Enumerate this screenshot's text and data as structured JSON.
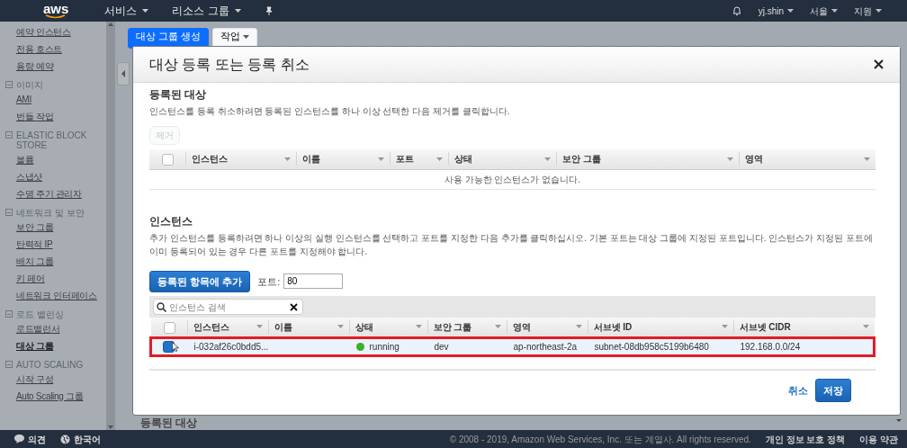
{
  "top_nav": {
    "logo": "aws",
    "menus": [
      {
        "label": "서비스"
      },
      {
        "label": "리소스 그룹"
      }
    ],
    "user": "yj.shin",
    "region": "서울",
    "support": "지원"
  },
  "sidebar": {
    "sections": [
      {
        "items": [
          {
            "label": "예약 인스턴스",
            "selected": false
          },
          {
            "label": "전용 호스트",
            "selected": false
          },
          {
            "label": "용량 예약",
            "selected": false
          }
        ]
      },
      {
        "title": "이미지",
        "items": [
          {
            "label": "AMI",
            "selected": false
          },
          {
            "label": "번들 작업",
            "selected": false
          }
        ]
      },
      {
        "title": "ELASTIC BLOCK STORE",
        "items": [
          {
            "label": "볼륨",
            "selected": false
          },
          {
            "label": "스냅샷",
            "selected": false
          },
          {
            "label": "수명 주기 관리자",
            "selected": false
          }
        ]
      },
      {
        "title": "네트워크 및 보안",
        "items": [
          {
            "label": "보안 그룹",
            "selected": false
          },
          {
            "label": "탄력적 IP",
            "selected": false
          },
          {
            "label": "배치 그룹",
            "selected": false
          },
          {
            "label": "키 페어",
            "selected": false
          },
          {
            "label": "네트워크 인터페이스",
            "selected": false
          }
        ]
      },
      {
        "title": "로드 밸런싱",
        "items": [
          {
            "label": "로드밸런서",
            "selected": false
          },
          {
            "label": "대상 그룹",
            "selected": true
          }
        ]
      },
      {
        "title": "AUTO SCALING",
        "items": [
          {
            "label": "시작 구성",
            "selected": false
          },
          {
            "label": "Auto Scaling 그룹",
            "selected": false
          }
        ]
      }
    ]
  },
  "page": {
    "buttons": [
      {
        "label": "대상 그룹 생성",
        "kind": "primary"
      },
      {
        "label": "작업",
        "kind": "dropdown"
      }
    ],
    "section_title": "등록된 대상"
  },
  "modal": {
    "title": "대상 등록 또는 등록 취소",
    "registered": {
      "title": "등록된 대상",
      "description": "인스턴스를 등록 취소하려면 등록된 인스턴스를 하나 이상 선택한 다음 제거를 클릭합니다.",
      "remove_button": {
        "label": "제거",
        "disabled": true
      },
      "all_selected": false,
      "columns": [
        "인스턴스",
        "이름",
        "포트",
        "상태",
        "보안 그룹",
        "영역"
      ],
      "empty_message": "사용 가능한 인스턴스가 없습니다."
    },
    "instances": {
      "title": "인스턴스",
      "description": "추가 인스턴스를 등록하려면 하나 이상의 실행 인스턴스를 선택하고 포트를 지정한 다음 추가를 클릭하십시오. 기본 포트는 대상 그룹에 지정된 포트입니다. 인스턴스가 지정된 포트에 이미 등록되어 있는 경우 다른 포트를 지정해야 합니다.",
      "add_button": "등록된 항목에 추가",
      "port_label": "포트:",
      "port_value": "80",
      "search": {
        "placeholder": "인스턴스 검색"
      },
      "all_selected": false,
      "columns": [
        "인스턴스",
        "이름",
        "상태",
        "보안 그룹",
        "영역",
        "서브넷 ID",
        "서브넷 CIDR"
      ],
      "rows": [
        {
          "selected": true,
          "highlighted": true,
          "instance": "i-032af26c0bdd5...",
          "status": {
            "label": "running",
            "color": "#3fae2a"
          },
          "security_group": "dev",
          "zone": "ap-northeast-2a",
          "subnet_id": "subnet-08db958c5199b6480",
          "subnet_cidr": "192.168.0.0/24"
        }
      ]
    },
    "cancel": "취소",
    "save": "저장"
  },
  "footer": {
    "feedback": "의견",
    "language": "한국어",
    "copyright": "© 2008 - 2019, Amazon Web Services, Inc. 또는 계열사. All rights reserved.",
    "links": [
      "개인 정보 보호 정책",
      "이용 약관"
    ]
  }
}
